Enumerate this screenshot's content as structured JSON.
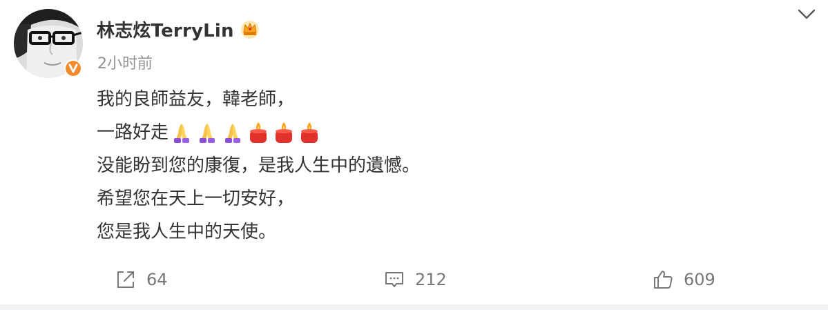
{
  "post": {
    "author": "林志炫TerryLin",
    "timestamp": "2小时前",
    "lines": {
      "line1": "我的良師益友，韓老師，",
      "line2": "一路好走",
      "line3": "没能盼到您的康復，是我人生中的遺憾。",
      "line4": "希望您在天上一切安好，",
      "line5": "您是我人生中的天使。"
    },
    "emojis": [
      "praying-hands",
      "praying-hands",
      "praying-hands",
      "candle",
      "candle",
      "candle"
    ]
  },
  "actions": {
    "repost_count": "64",
    "comment_count": "212",
    "like_count": "609"
  },
  "colors": {
    "text": "#333333",
    "muted": "#939393",
    "icon": "#777777",
    "verify_badge": "#f58a2a",
    "candle_red": "#e0322a",
    "flame_orange": "#ffa31a",
    "praying_purple": "#8a4fd9"
  },
  "icons": {
    "verify": "verified-badge-icon",
    "crown": "crown-badge-icon",
    "more": "chevron-down-icon",
    "repost": "repost-icon",
    "comment": "comment-icon",
    "like": "thumbs-up-icon"
  }
}
